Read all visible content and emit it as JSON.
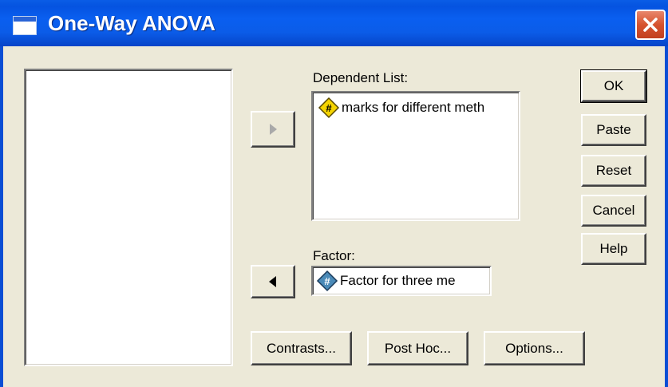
{
  "window": {
    "title": "One-Way ANOVA"
  },
  "dependent": {
    "label": "Dependent List:",
    "items": [
      {
        "name": "marks for different meth"
      }
    ]
  },
  "factor": {
    "label": "Factor:",
    "value": "Factor for three me"
  },
  "buttons": {
    "ok": "OK",
    "paste": "Paste",
    "reset": "Reset",
    "cancel": "Cancel",
    "help": "Help",
    "contrasts": "Contrasts...",
    "post_hoc": "Post Hoc...",
    "options": "Options..."
  },
  "icons": {
    "scale_variable": "scale-variable-icon",
    "arrow_right": "arrow-right-icon",
    "arrow_left": "arrow-left-icon"
  },
  "colors": {
    "titlebar": "#0553e0",
    "dialog_bg": "#ece9d8",
    "close_button": "#d6532f",
    "scale_icon": "#f5d400",
    "factor_icon": "#4a8ab8"
  }
}
